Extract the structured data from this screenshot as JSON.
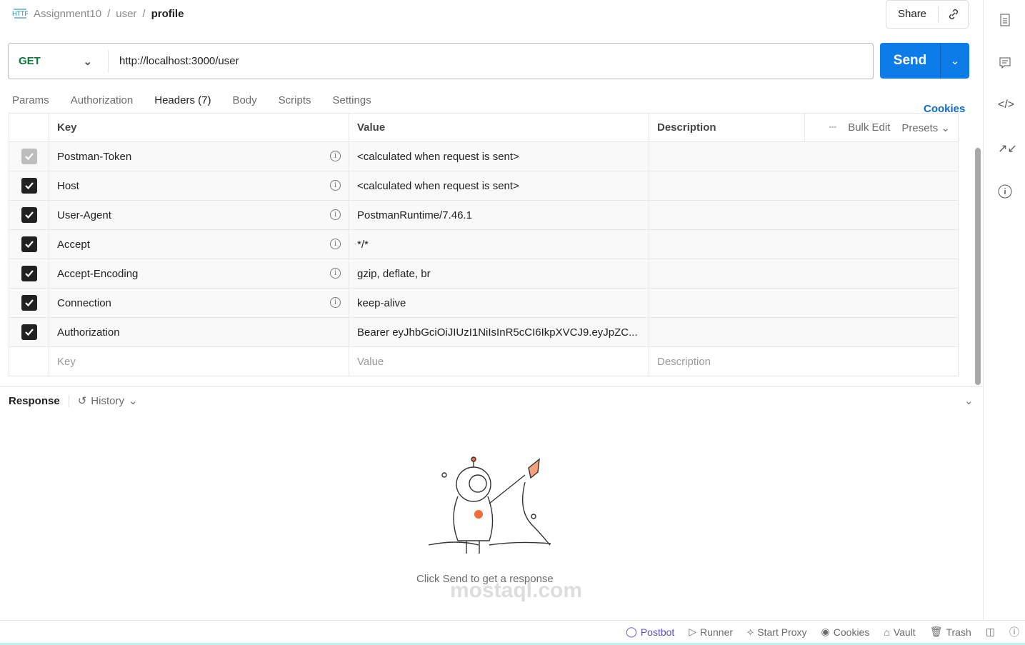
{
  "breadcrumb": {
    "collection": "Assignment10",
    "folder": "user",
    "request": "profile"
  },
  "share_label": "Share",
  "request": {
    "method": "GET",
    "url": "http://localhost:3000/user",
    "send_label": "Send"
  },
  "tabs": [
    "Params",
    "Authorization",
    "Headers (7)",
    "Body",
    "Scripts",
    "Settings"
  ],
  "cookies_link": "Cookies",
  "headers_table": {
    "columns": {
      "key": "Key",
      "value": "Value",
      "description": "Description"
    },
    "tools": {
      "bulk_edit": "Bulk Edit",
      "presets": "Presets"
    },
    "rows": [
      {
        "key": "Postman-Token",
        "value": "<calculated when request is sent>"
      },
      {
        "key": "Host",
        "value": "<calculated when request is sent>"
      },
      {
        "key": "User-Agent",
        "value": "PostmanRuntime/7.46.1"
      },
      {
        "key": "Accept",
        "value": "*/*"
      },
      {
        "key": "Accept-Encoding",
        "value": "gzip, deflate, br"
      },
      {
        "key": "Connection",
        "value": "keep-alive"
      },
      {
        "key": "Authorization",
        "value": "Bearer eyJhbGciOiJIUzI1NiIsInR5cCI6IkpXVCJ9.eyJpZC..."
      }
    ],
    "placeholders": {
      "key": "Key",
      "value": "Value",
      "description": "Description"
    }
  },
  "response": {
    "title": "Response",
    "history": "History",
    "empty_text": "Click Send to get a response"
  },
  "watermark": "mostaql.com",
  "footer": [
    "Postbot",
    "Runner",
    "Start Proxy",
    "Cookies",
    "Vault",
    "Trash"
  ]
}
